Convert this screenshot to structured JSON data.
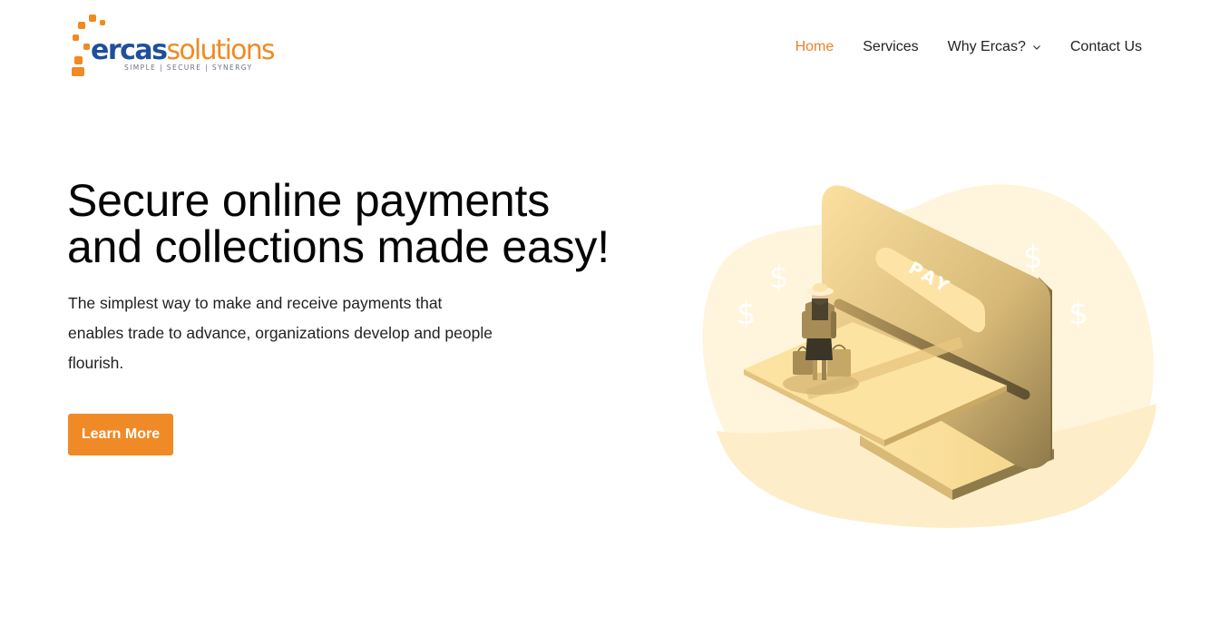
{
  "brand": {
    "name_part1": "ercas",
    "name_part2": "solutions",
    "tagline": "SIMPLE | SECURE | SYNERGY",
    "colors": {
      "orange": "#f08a23",
      "blue": "#1d4f9c"
    }
  },
  "nav": {
    "items": [
      {
        "label": "Home",
        "active": true
      },
      {
        "label": "Services",
        "active": false
      },
      {
        "label": "Why Ercas?",
        "active": false,
        "icon": "chevron-down-icon"
      },
      {
        "label": "Contact Us",
        "active": false
      }
    ]
  },
  "hero": {
    "title_line1": "Secure online payments",
    "title_line2": "and collections made easy!",
    "description": "The simplest way to make and receive payments that enables trade to advance, organizations develop and people flourish.",
    "cta_label": "Learn More"
  },
  "illustration": {
    "screen_label": "PAY",
    "currency_symbol": "$"
  },
  "colors": {
    "accent": "#ef8a27",
    "nav_active": "#e8832a"
  }
}
